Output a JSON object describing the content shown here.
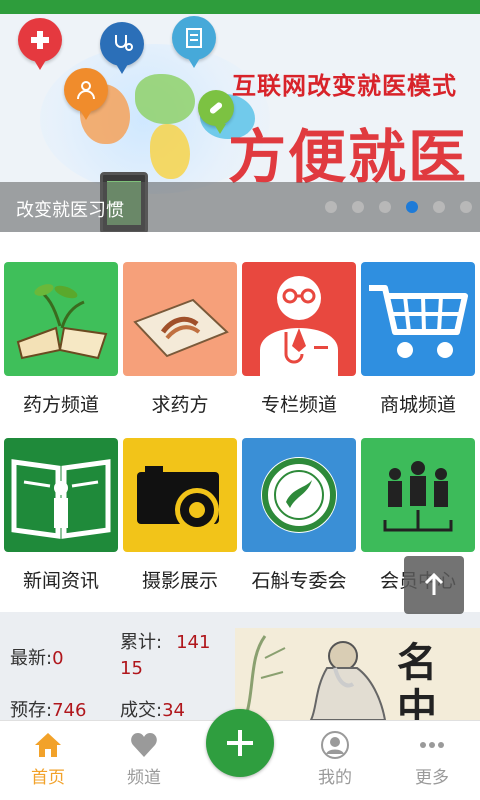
{
  "banner": {
    "slogan": "互联网改变就医模式",
    "title": "方便就医",
    "caption": "改变就医习惯",
    "dots_total": 6,
    "dots_active_index": 3
  },
  "grid": {
    "items": [
      {
        "label": "药方频道",
        "icon": "herb-book-icon",
        "color": "#3fbf5a"
      },
      {
        "label": "求药方",
        "icon": "prescription-paper-icon",
        "color": "#f6a07a"
      },
      {
        "label": "专栏频道",
        "icon": "doctor-icon",
        "color": "#e8483f"
      },
      {
        "label": "商城频道",
        "icon": "shopping-cart-icon",
        "color": "#2f8fe0"
      },
      {
        "label": "新闻资讯",
        "icon": "info-book-icon",
        "color": "#1f8a3a"
      },
      {
        "label": "摄影展示",
        "icon": "camera-icon",
        "color": "#f2c419"
      },
      {
        "label": "石斛专委会",
        "icon": "committee-badge-icon",
        "color": "#3a8fd6"
      },
      {
        "label": "会员中心",
        "icon": "members-icon",
        "color": "#3dbb5a"
      }
    ]
  },
  "stats": {
    "latest_label": "最新:",
    "latest_value": "0",
    "total_label": "累计:",
    "total_value_line1": "141",
    "total_value_line2": "15",
    "stock_label": "预存:",
    "stock_value": "746",
    "deal_label": "成交:",
    "deal_value": "34"
  },
  "painting": {
    "chars": [
      "名",
      "中"
    ]
  },
  "tabbar": {
    "home": "首页",
    "channel": "频道",
    "mine": "我的",
    "more": "更多"
  },
  "colors": {
    "brand_green": "#2f9e3f",
    "active_tab": "#f2a22a",
    "stat_value": "#b0161c",
    "active_dot": "#1e7bd8"
  }
}
